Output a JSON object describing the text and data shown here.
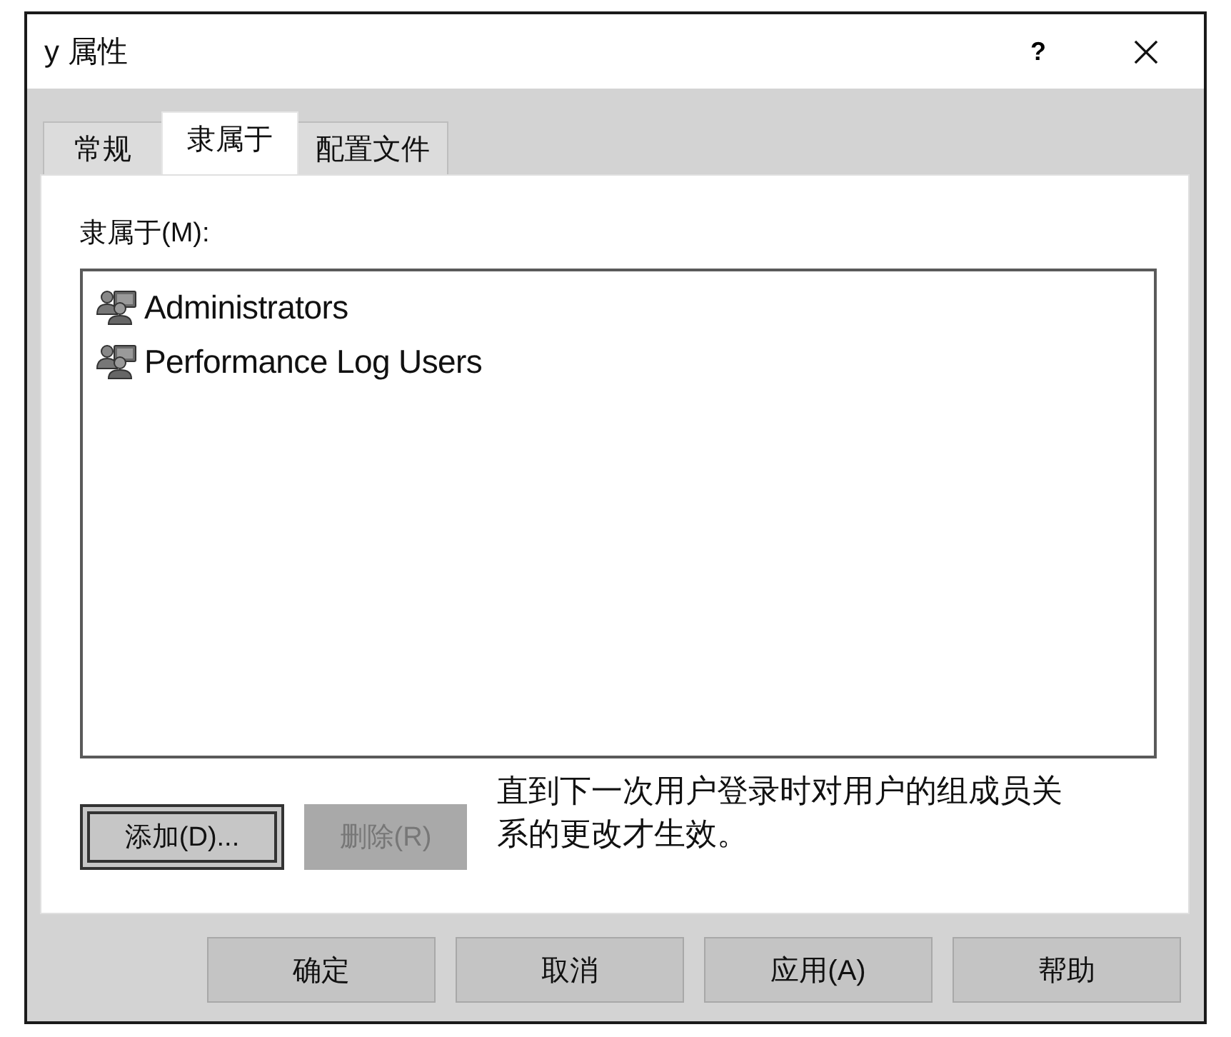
{
  "window": {
    "title": "y 属性",
    "help_button": "?"
  },
  "tabs": [
    {
      "label": "常规",
      "selected": false
    },
    {
      "label": "隶属于",
      "selected": true
    },
    {
      "label": "配置文件",
      "selected": false
    }
  ],
  "member_of": {
    "label": "隶属于(M):",
    "items": [
      {
        "name": "Administrators"
      },
      {
        "name": "Performance Log Users"
      }
    ],
    "buttons": [
      {
        "label": "添加(D)...",
        "disabled": false,
        "focused": true
      },
      {
        "label": "删除(R)",
        "disabled": true,
        "focused": false
      }
    ],
    "note": "直到下一次用户登录时对用户的组成员关系的更改才生效。"
  },
  "buttons": [
    {
      "label": "确定"
    },
    {
      "label": "取消"
    },
    {
      "label": "应用(A)"
    },
    {
      "label": "帮助"
    }
  ]
}
